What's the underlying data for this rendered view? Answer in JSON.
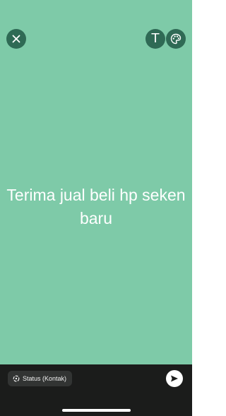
{
  "editor": {
    "background_color": "#7ecaa8",
    "text": "Terima jual beli hp seken baru"
  },
  "toolbar": {
    "close_icon": "close-icon",
    "text_tool_label": "T",
    "palette_icon": "palette-icon",
    "button_color": "#2f6a55"
  },
  "footer": {
    "audience_label": "Status (Kontak)",
    "audience_icon": "status-ring-icon",
    "send_icon": "send-icon"
  }
}
